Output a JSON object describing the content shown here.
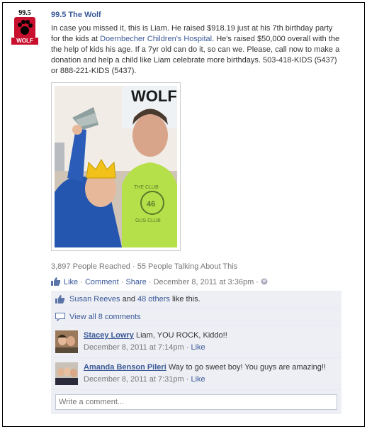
{
  "logo": {
    "top_text": "99.5",
    "bottom_text": "WOLF"
  },
  "post": {
    "author": "99.5 The Wolf",
    "text_before_link": "In case you missed it, this is Liam. He raised $918.19 just at his 7th birthday party for the kids at ",
    "link_text": "Doernbecher Children's Hospital",
    "text_after_link": ". He's raised $50,000 overall with the the help of kids his age. If a 7yr old can do it, so can we. Please, call now to make a donation and help a child like Liam celebrate more birthdays. 503-418-KIDS (5437) or 888-221-KIDS (5437).",
    "photo_banner_text": "WOLF",
    "shirt_text_top": "THE CLUB",
    "shirt_text_num": "46",
    "shirt_text_bottom": "GUS CLUB"
  },
  "stats": {
    "reached": "3,897 People Reached",
    "sep": " · ",
    "talking": "55 People Talking About This"
  },
  "actions": {
    "like": "Like",
    "comment": "Comment",
    "share": "Share",
    "date": "December 8, 2011 at 3:36pm",
    "sep": " · "
  },
  "likes_row": {
    "name": "Susan Reeves",
    "and": " and ",
    "others": "48 others",
    "suffix": " like this."
  },
  "view_all": "View all 8 comments",
  "comments": [
    {
      "name": "Stacey Lowry",
      "text": " Liam, YOU ROCK, Kiddo!!",
      "time": "December 8, 2011 at 7:14pm",
      "like": "Like",
      "sep": " · "
    },
    {
      "name": "Amanda Benson Pileri",
      "text": " Way to go sweet boy! You guys are amazing!!",
      "time": "December 8, 2011 at 7:31pm",
      "like": "Like",
      "sep": " · "
    }
  ],
  "write_comment": {
    "placeholder": "Write a comment..."
  }
}
